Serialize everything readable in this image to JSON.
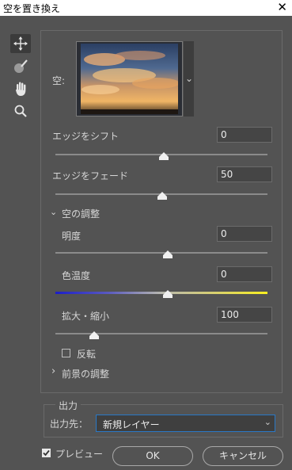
{
  "window": {
    "title": "空を置き換え",
    "close_glyph": "✕"
  },
  "tools": [
    "move-tool-icon",
    "sky-brush-icon",
    "hand-icon",
    "zoom-icon"
  ],
  "sky": {
    "label": "空:",
    "caret": "⌄"
  },
  "shift_edge": {
    "label": "エッジをシフト",
    "value": "0",
    "level": 0.5
  },
  "fade_edge": {
    "label": "エッジをフェード",
    "value": "50",
    "level": 0.5
  },
  "sky_adjust": {
    "header": "空の調整",
    "chevron": "⌄",
    "brightness": {
      "label": "明度",
      "value": "0",
      "level": 0.5
    },
    "temperature": {
      "label": "色温度",
      "value": "0",
      "level": 0.5,
      "gradient": [
        "#1c1ec8",
        "#f8ef20"
      ]
    },
    "scale": {
      "label": "拡大・縮小",
      "value": "100",
      "level": 0.17
    },
    "flip": {
      "label": "反転",
      "checked": false
    }
  },
  "foreground_adjust": {
    "header": "前景の調整",
    "chevron": "›"
  },
  "output": {
    "group_title": "出力",
    "output_to_label": "出力先：",
    "output_to_value": "新規レイヤー",
    "caret": "⌄"
  },
  "preview": {
    "label": "プレビュー",
    "checked": true
  },
  "buttons": {
    "ok": "OK",
    "cancel": "キャンセル"
  },
  "colors": {
    "background": "#535353",
    "focus": "#2a78c6"
  }
}
